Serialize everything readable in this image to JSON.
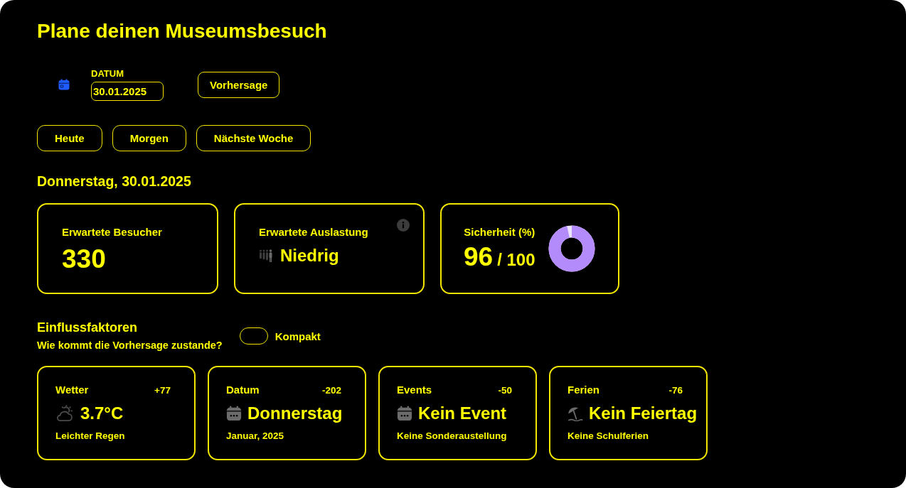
{
  "title": "Plane deinen Museumsbesuch",
  "date_picker": {
    "label": "DATUM",
    "value": "30.01.2025"
  },
  "forecast_button": "Vorhersage",
  "quick_buttons": [
    "Heute",
    "Morgen",
    "Nächste Woche"
  ],
  "selected_day": "Donnerstag, 30.01.2025",
  "summary_cards": [
    {
      "kind": "count",
      "label": "Erwartete Besucher",
      "value": "330"
    },
    {
      "kind": "occupancy",
      "label": "Erwartete Auslastung",
      "value": "Niedrig"
    },
    {
      "kind": "confidence",
      "label": "Sicherheit (%)",
      "value": "96",
      "total": "/ 100",
      "level": 0.96
    }
  ],
  "factors": {
    "title": "Einflussfaktoren",
    "subtitle": "Wie kommt die Vorhersage zustande?",
    "compact_toggle": {
      "label": "Kompakt",
      "on": false
    },
    "cards": [
      {
        "kind": "weather",
        "label": "Wetter",
        "impact": "+77",
        "value": "3.7°C",
        "detail": "Leichter Regen"
      },
      {
        "kind": "date",
        "label": "Datum",
        "impact": "-202",
        "value": "Donnerstag",
        "detail": "Januar, 2025"
      },
      {
        "kind": "event",
        "label": "Events",
        "impact": "-50",
        "value": "Kein Event",
        "detail": "Keine Sonderaustellung"
      },
      {
        "kind": "holiday",
        "label": "Ferien",
        "impact": "-76",
        "value": "Kein Feiertag",
        "detail": "Keine Schulferien"
      }
    ]
  }
}
